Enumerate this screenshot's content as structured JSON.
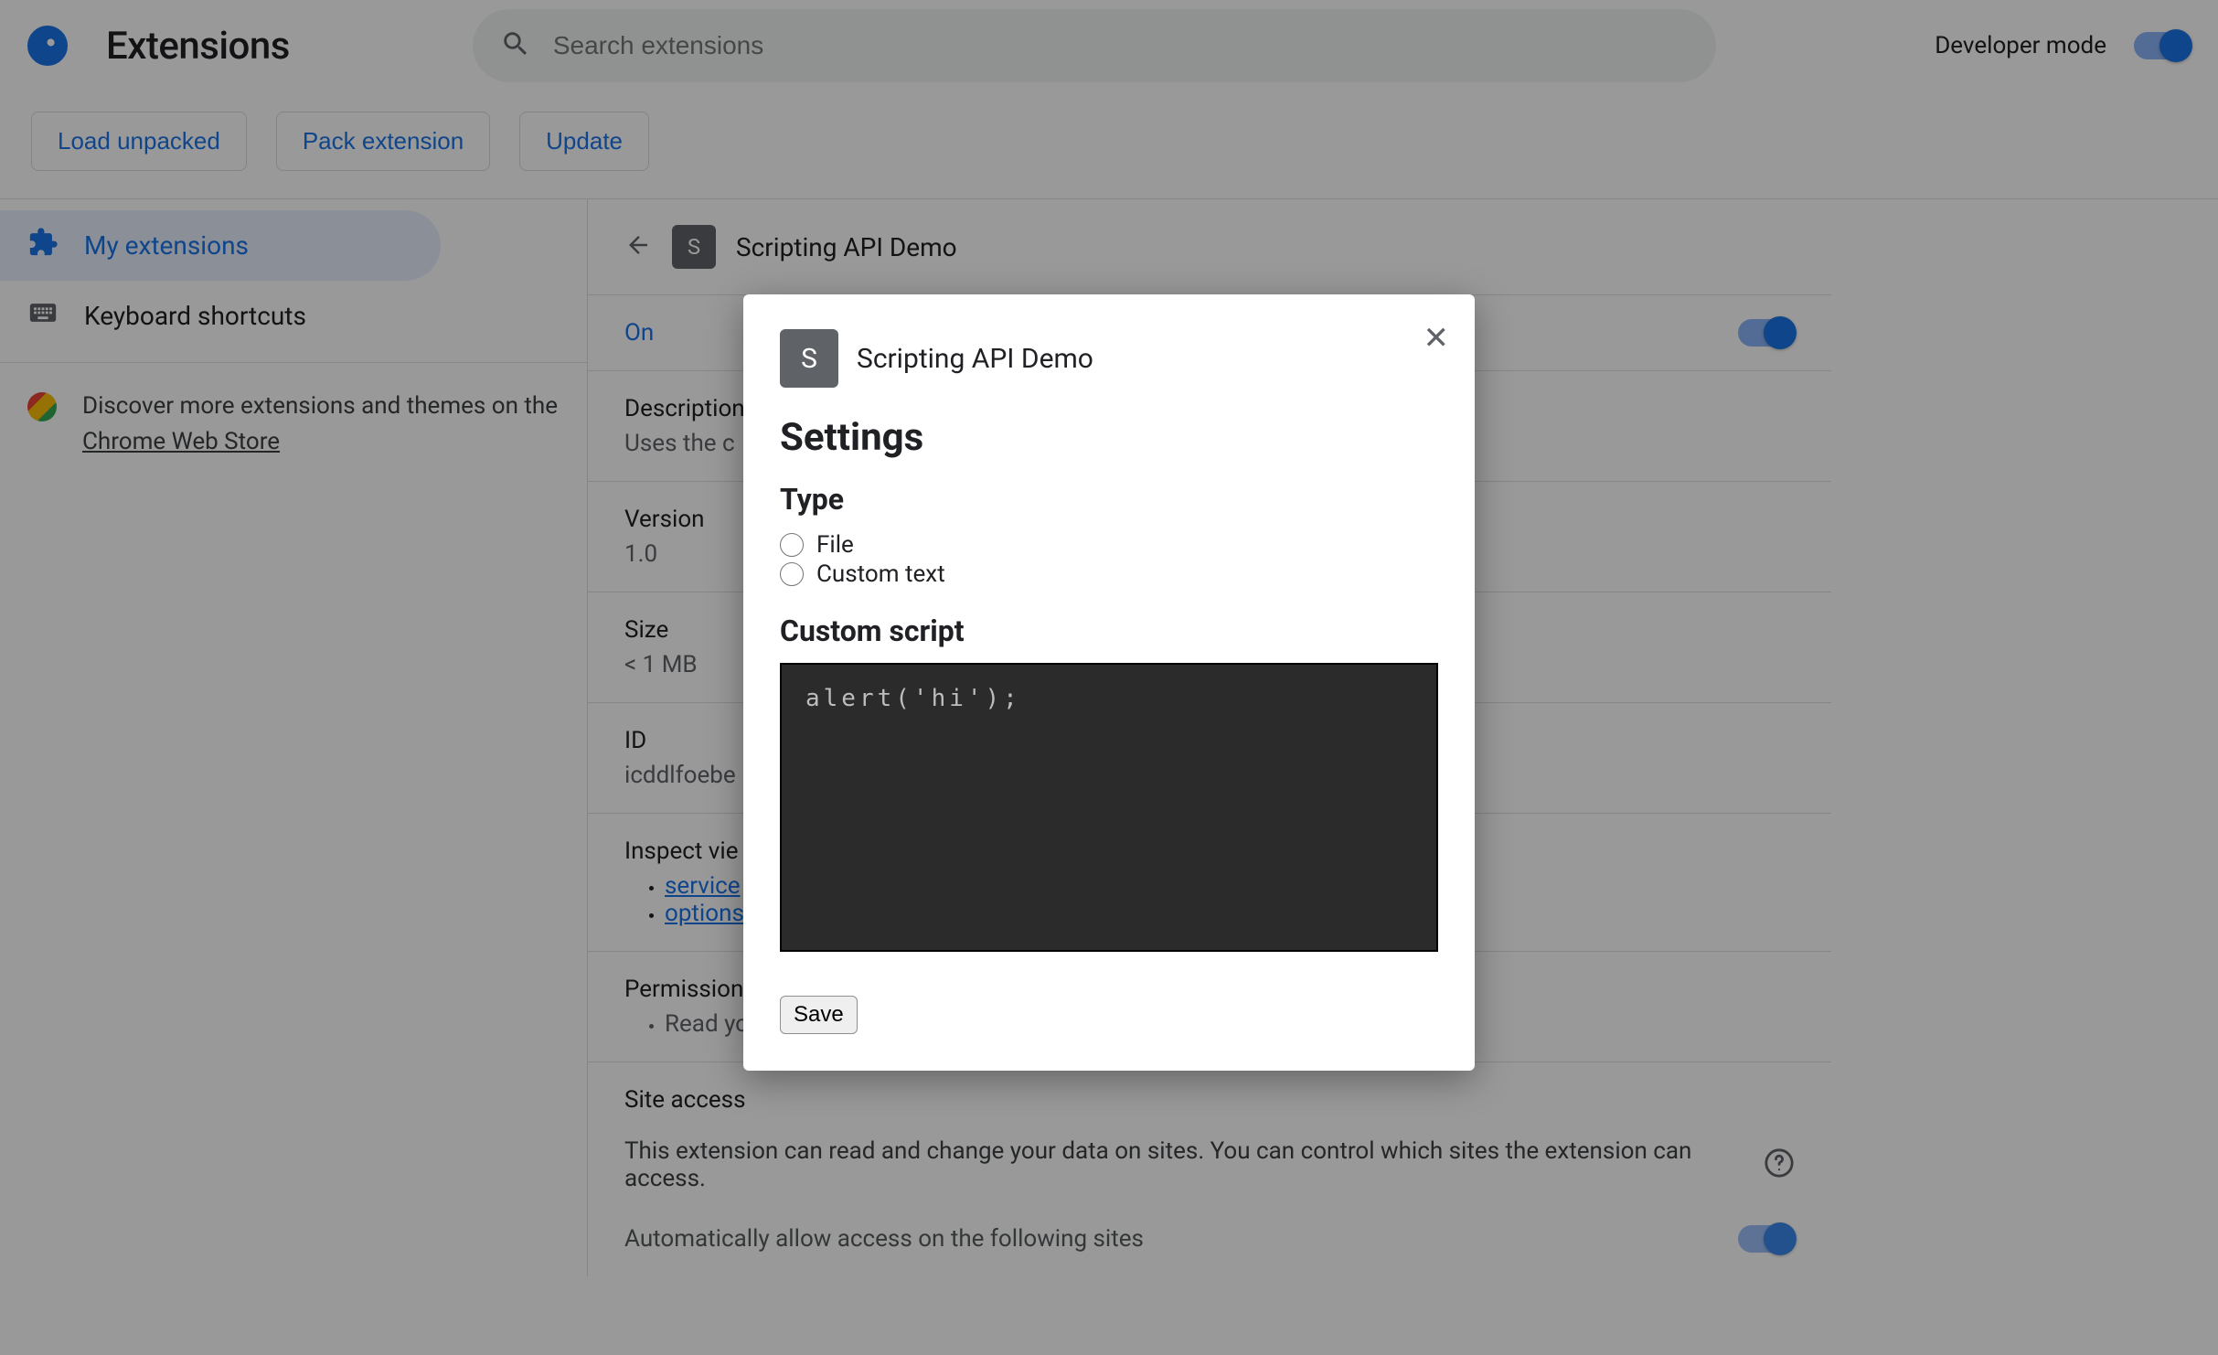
{
  "header": {
    "page_title": "Extensions",
    "search_placeholder": "Search extensions",
    "dev_mode_label": "Developer mode",
    "dev_mode_on": true
  },
  "actions": {
    "load_unpacked": "Load unpacked",
    "pack_extension": "Pack extension",
    "update": "Update"
  },
  "sidebar": {
    "my_extensions": "My extensions",
    "keyboard_shortcuts": "Keyboard shortcuts",
    "discover_prefix": "Discover more extensions and themes on the ",
    "store_link": "Chrome Web Store"
  },
  "detail": {
    "badge_letter": "S",
    "name": "Scripting API Demo",
    "on_label": "On",
    "on_value": true,
    "description_label": "Description",
    "description_value": "Uses the c",
    "version_label": "Version",
    "version_value": "1.0",
    "size_label": "Size",
    "size_value": "< 1 MB",
    "id_label": "ID",
    "id_value": "icddlfoebe",
    "inspect_label": "Inspect vie",
    "inspect_links": [
      "service",
      "options"
    ],
    "permissions_label": "Permission",
    "permissions_items": [
      "Read yo"
    ],
    "site_access_label": "Site access",
    "site_access_desc": "This extension can read and change your data on sites. You can control which sites the extension can access.",
    "auto_allow_label": "Automatically allow access on the following sites"
  },
  "modal": {
    "badge_letter": "S",
    "ext_name": "Scripting API Demo",
    "settings_heading": "Settings",
    "type_heading": "Type",
    "type_options": [
      "File",
      "Custom text"
    ],
    "custom_script_heading": "Custom script",
    "script_value": "alert('hi');",
    "save_label": "Save"
  }
}
